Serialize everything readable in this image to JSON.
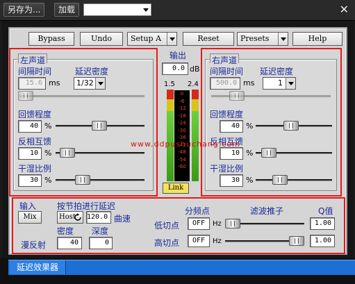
{
  "host": {
    "save_as": "另存为...",
    "load": "加载",
    "preset_value": "",
    "close_glyph": "✕"
  },
  "toolbar": {
    "bypass": "Bypass",
    "undo": "Undo",
    "setup": "Setup A",
    "reset": "Reset",
    "presets": "Presets",
    "help": "Help"
  },
  "left": {
    "title": "左声道",
    "interval_label": "间隔时间",
    "delay_density_label": "延迟密度",
    "interval_value": "15.6",
    "interval_unit": "ms",
    "density_value": "1/32",
    "feedback_label": "回馈程度",
    "feedback_value": "40",
    "invert_label": "反相互馈",
    "invert_value": "10",
    "drywet_label": "干湿比例",
    "drywet_value": "30",
    "percent": "%"
  },
  "output": {
    "label": "输出",
    "value": "0.0",
    "unit": "dB",
    "peak_left": "1.5",
    "peak_right": "2.4",
    "scale": [
      "0",
      "-6",
      "-12",
      "-18",
      "-24",
      "-30",
      "-36",
      "-42",
      "-48",
      "-54",
      "-60"
    ],
    "link": "Link"
  },
  "right": {
    "title": "右声道",
    "interval_label": "间隔时间",
    "delay_density_label": "延迟密度",
    "interval_value": "500.0",
    "interval_unit": "ms",
    "density_value": "1",
    "feedback_label": "回馈程度",
    "feedback_value": "40",
    "invert_label": "反相互馈",
    "invert_value": "10",
    "drywet_label": "干湿比例",
    "drywet_value": "30",
    "percent": "%"
  },
  "bottom": {
    "input_label": "输入",
    "input_value": "Mix",
    "beat_label": "按节拍进行延迟",
    "host_value": "Host",
    "tempo_value": "120.0",
    "curve_label": "曲速",
    "density_label": "密度",
    "depth_label": "深度",
    "diffuse_label": "漫反射",
    "density_value": "40",
    "depth_value": "0",
    "crossover_label": "分频点",
    "filter_slope_label": "滤波推子",
    "q_label": "Q值",
    "low_cut_label": "低切点",
    "high_cut_label": "高切点",
    "low_cut_value": "OFF",
    "high_cut_value": "OFF",
    "hz": "Hz",
    "low_q": "1.00",
    "high_q": "1.00"
  },
  "watermark": "www.ddpushuchang.com",
  "status_tab": "延迟效果器",
  "colors": {
    "highlight": "#e21b1b",
    "label_blue": "#1a2a9a",
    "status_blue": "#1e6fd4"
  }
}
